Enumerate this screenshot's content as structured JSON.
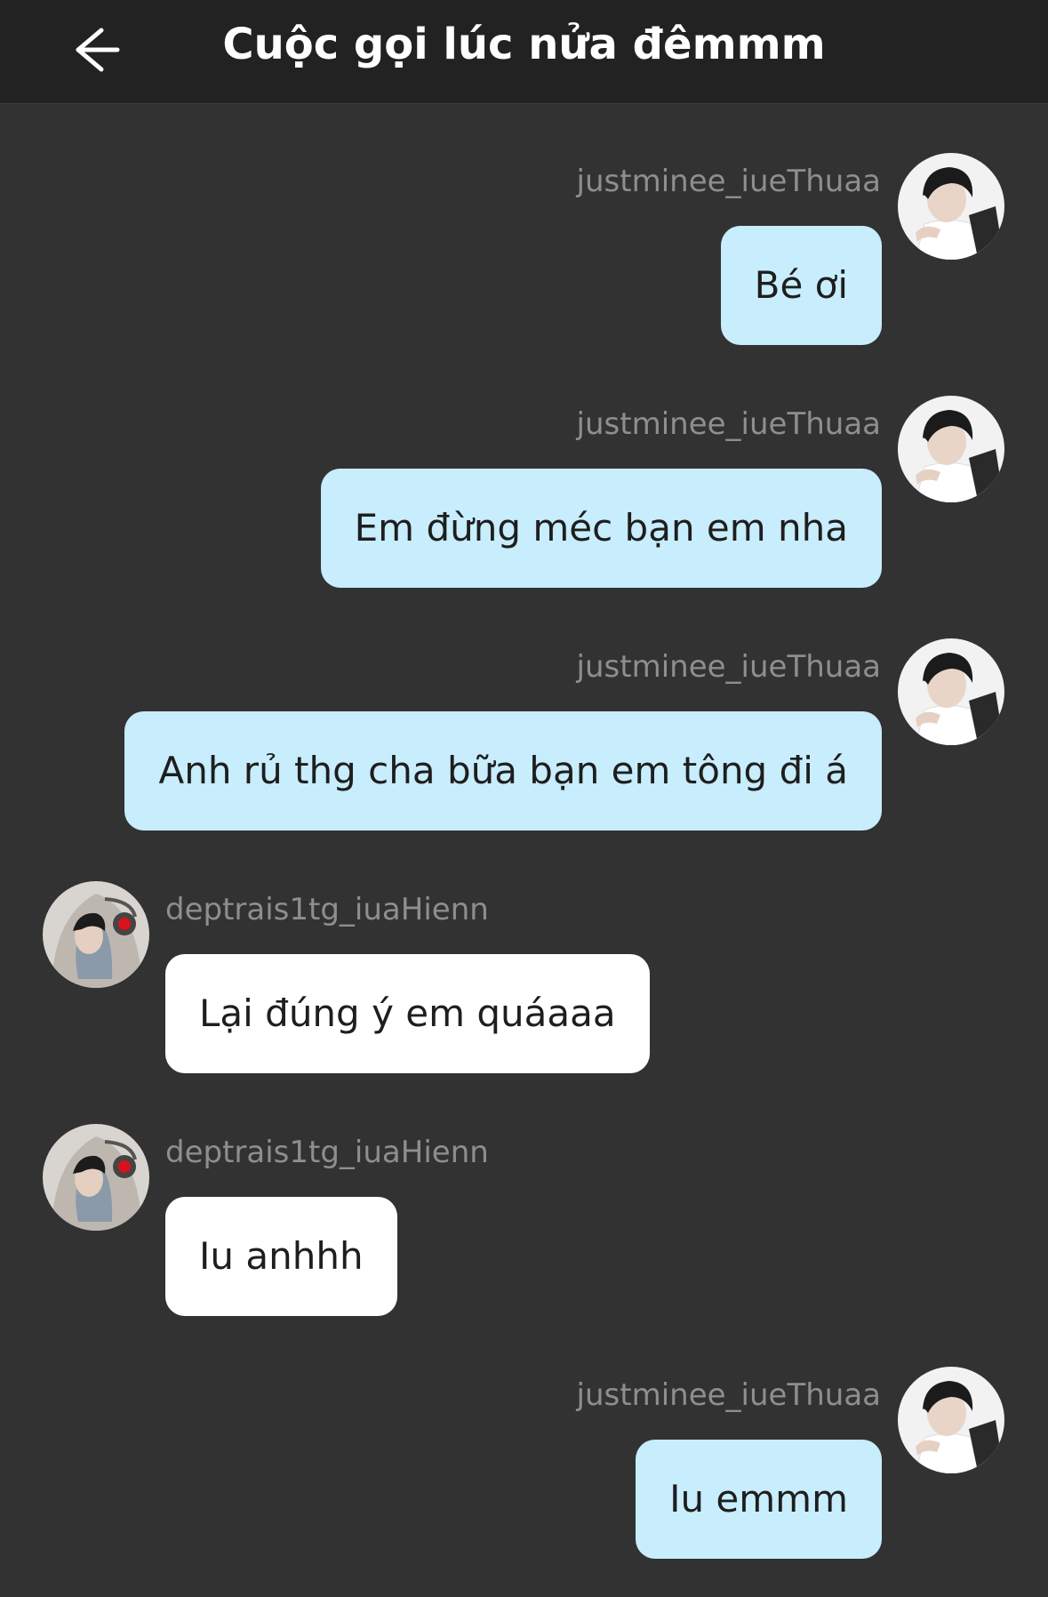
{
  "header": {
    "title": "Cuộc gọi lúc nửa đêmmm",
    "back_icon": "arrow-left-icon"
  },
  "messages": [
    {
      "side": "right",
      "username": "justminee_iueThuaa",
      "text": "Bé ơi"
    },
    {
      "side": "right",
      "username": "justminee_iueThuaa",
      "text": "Em đừng méc bạn em nha"
    },
    {
      "side": "right",
      "username": "justminee_iueThuaa",
      "text": "Anh rủ thg cha bữa bạn em tông đi á"
    },
    {
      "side": "left",
      "username": "deptrais1tg_iuaHienn",
      "text": "Lại đúng ý em quáaaa"
    },
    {
      "side": "left",
      "username": "deptrais1tg_iuaHienn",
      "text": "Iu anhhh"
    },
    {
      "side": "right",
      "username": "justminee_iueThuaa",
      "text": "Iu emmm"
    }
  ],
  "colors": {
    "background": "#323232",
    "header": "#222222",
    "right_bubble": "#c8edfd",
    "left_bubble": "#ffffff",
    "username": "#8e8e8e"
  }
}
